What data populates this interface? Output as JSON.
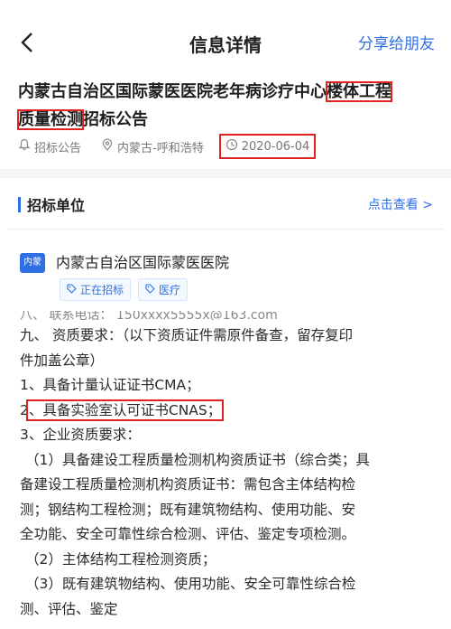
{
  "header": {
    "title": "信息详情",
    "share_label": "分享给朋友"
  },
  "article": {
    "title_part1": "内蒙古自治区国际蒙医医院老年病诊疗中心",
    "title_part2": "楼体工程",
    "title_part3": "质量检测",
    "title_part4": "招标公告",
    "category": "招标公告",
    "location": "内蒙古-呼和浩特",
    "date": "2020-06-04"
  },
  "section": {
    "title": "招标单位",
    "link_label": "点击查看 >"
  },
  "org": {
    "logo_text": "内蒙",
    "name": "内蒙古自治区国际蒙医医院",
    "tags": [
      "正在招标",
      "医疗"
    ]
  },
  "content": {
    "cut_line": "八、 联系电话： 150xxxx5555x@163.com",
    "l1": "九、 资质要求：（以下资质证件需原件备查，留存复印",
    "l2": "件加盖公章）",
    "l3": "1、具备计量认证证书CMA；",
    "l4_pre": "2",
    "l4_hl": "、具备实验室认可证书CNAS；",
    "l5": "3、企业资质要求：",
    "l6": "（1）具备建设工程质量检测机构资质证书（综合类；具",
    "l7": "备建设工程质量检测机构资质证书：需包含主体结构检",
    "l8": "测；钢结构工程检测；既有建筑物结构、使用功能、安",
    "l9": "全功能、安全可靠性综合检测、评估、鉴定专项检测。",
    "l10": "（2）主体结构工程检测资质；",
    "l11": "（3）既有建筑物结构、使用功能、安全可靠性综合检",
    "l12": "测、评估、鉴定"
  },
  "colors": {
    "accent": "#2f6fe3",
    "highlight_box": "#e02222"
  }
}
